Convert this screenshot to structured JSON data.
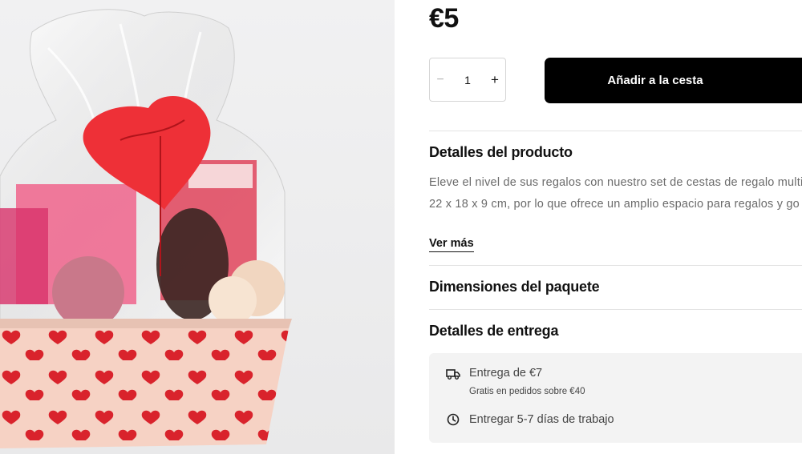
{
  "product": {
    "price": "€5",
    "quantity": "1",
    "minus_symbol": "−",
    "plus_symbol": "+",
    "add_to_cart_label": "Añadir a la cesta",
    "image_alt_label": "Cesta de regalo con corazones"
  },
  "details": {
    "title": "Detalles del producto",
    "description_line_1": "Eleve el nivel de sus regalos con nuestro set de cestas de regalo multi",
    "description_line_2": "22 x 18 x 9 cm, por lo que ofrece un amplio espacio para regalos y go",
    "read_more_label": "Ver más"
  },
  "package": {
    "title": "Dimensiones del paquete"
  },
  "delivery": {
    "title": "Detalles de entrega",
    "shipping_label": "Entrega de €7",
    "free_shipping_note": "Gratis en pedidos sobre €40",
    "time_label": "Entregar 5-7 días de trabajo",
    "shipping_icon": "truck-icon",
    "time_icon": "clock-icon"
  },
  "colors": {
    "button_background": "#000000",
    "delivery_box_background": "#f3f3f3",
    "heart_red": "#e3262d"
  }
}
